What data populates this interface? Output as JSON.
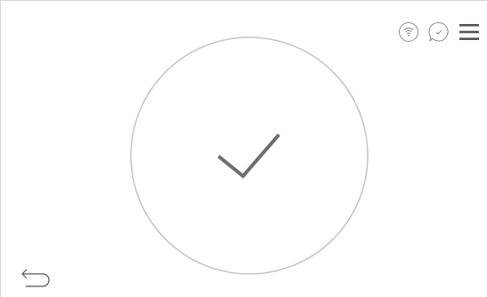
{
  "status_bar": {
    "icons": [
      "wifi-icon",
      "chat-confirm-icon",
      "hamburger-menu-icon"
    ]
  },
  "confirmation": {
    "state": "success",
    "icon": "checkmark-icon"
  },
  "navigation": {
    "back_icon": "back-arrow-icon"
  },
  "colors": {
    "background": "#ffffff",
    "circle_stroke": "#c4c4c4",
    "checkmark": "#6e6e6e",
    "icon_stroke": "#8a8a8a",
    "menu_icon": "#555555",
    "frame_border": "#d6d6d6"
  }
}
